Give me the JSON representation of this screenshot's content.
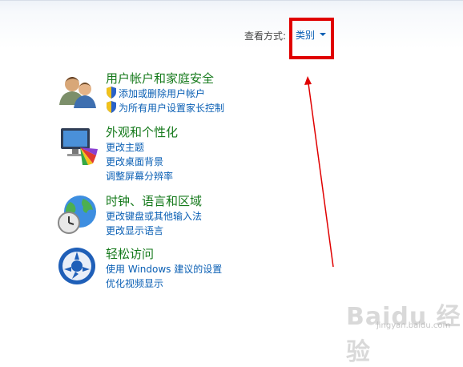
{
  "view_by": {
    "label": "查看方式:",
    "value": "类别"
  },
  "categories": [
    {
      "title": "用户帐户和家庭安全",
      "links": [
        "添加或删除用户帐户",
        "为所有用户设置家长控制"
      ]
    },
    {
      "title": "外观和个性化",
      "links": [
        "更改主题",
        "更改桌面背景",
        "调整屏幕分辨率"
      ]
    },
    {
      "title": "时钟、语言和区域",
      "links": [
        "更改键盘或其他输入法",
        "更改显示语言"
      ]
    },
    {
      "title": "轻松访问",
      "links": [
        "使用 Windows 建议的设置",
        "优化视频显示"
      ]
    }
  ],
  "watermark": {
    "brand": "Baidu 经验",
    "url": "jingyan.baidu.com"
  },
  "colors": {
    "link": "#0a5fb4",
    "category_title": "#167a1c",
    "highlight": "#e00000"
  }
}
